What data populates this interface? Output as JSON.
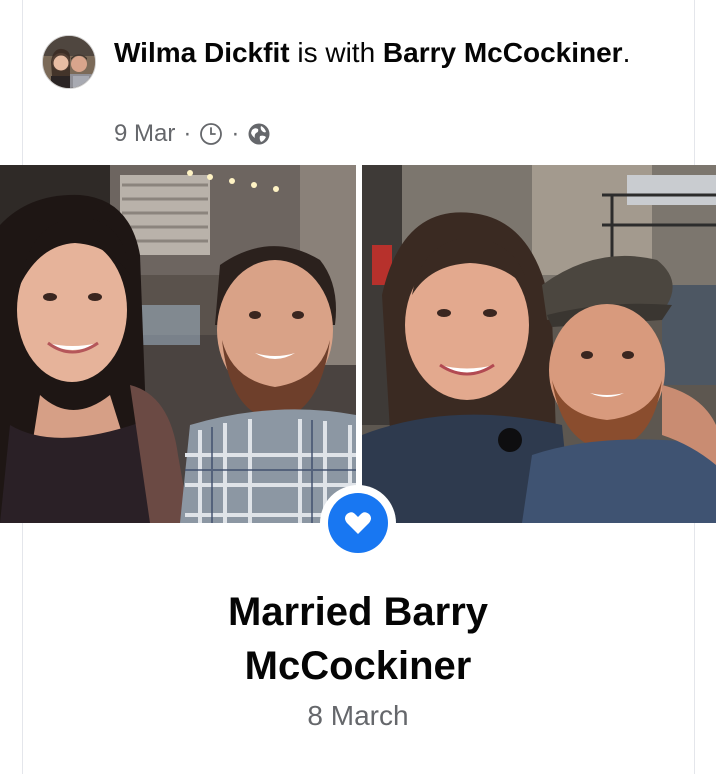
{
  "post": {
    "author": "Wilma Dickfit",
    "with_text": " is with ",
    "tagged": "Barry McCockiner",
    "end_punct": ".",
    "date": "9 Mar",
    "separator": "·",
    "icons": [
      "clock-icon",
      "globe-icon"
    ]
  },
  "photos": [
    {
      "name": "photo-left"
    },
    {
      "name": "photo-right"
    }
  ],
  "life_event": {
    "icon": "heart-icon",
    "title": "Married Barry McCockiner",
    "date": "8 March"
  },
  "colors": {
    "accent": "#1877f2",
    "secondary_text": "#65676b",
    "primary_text": "#050505"
  }
}
